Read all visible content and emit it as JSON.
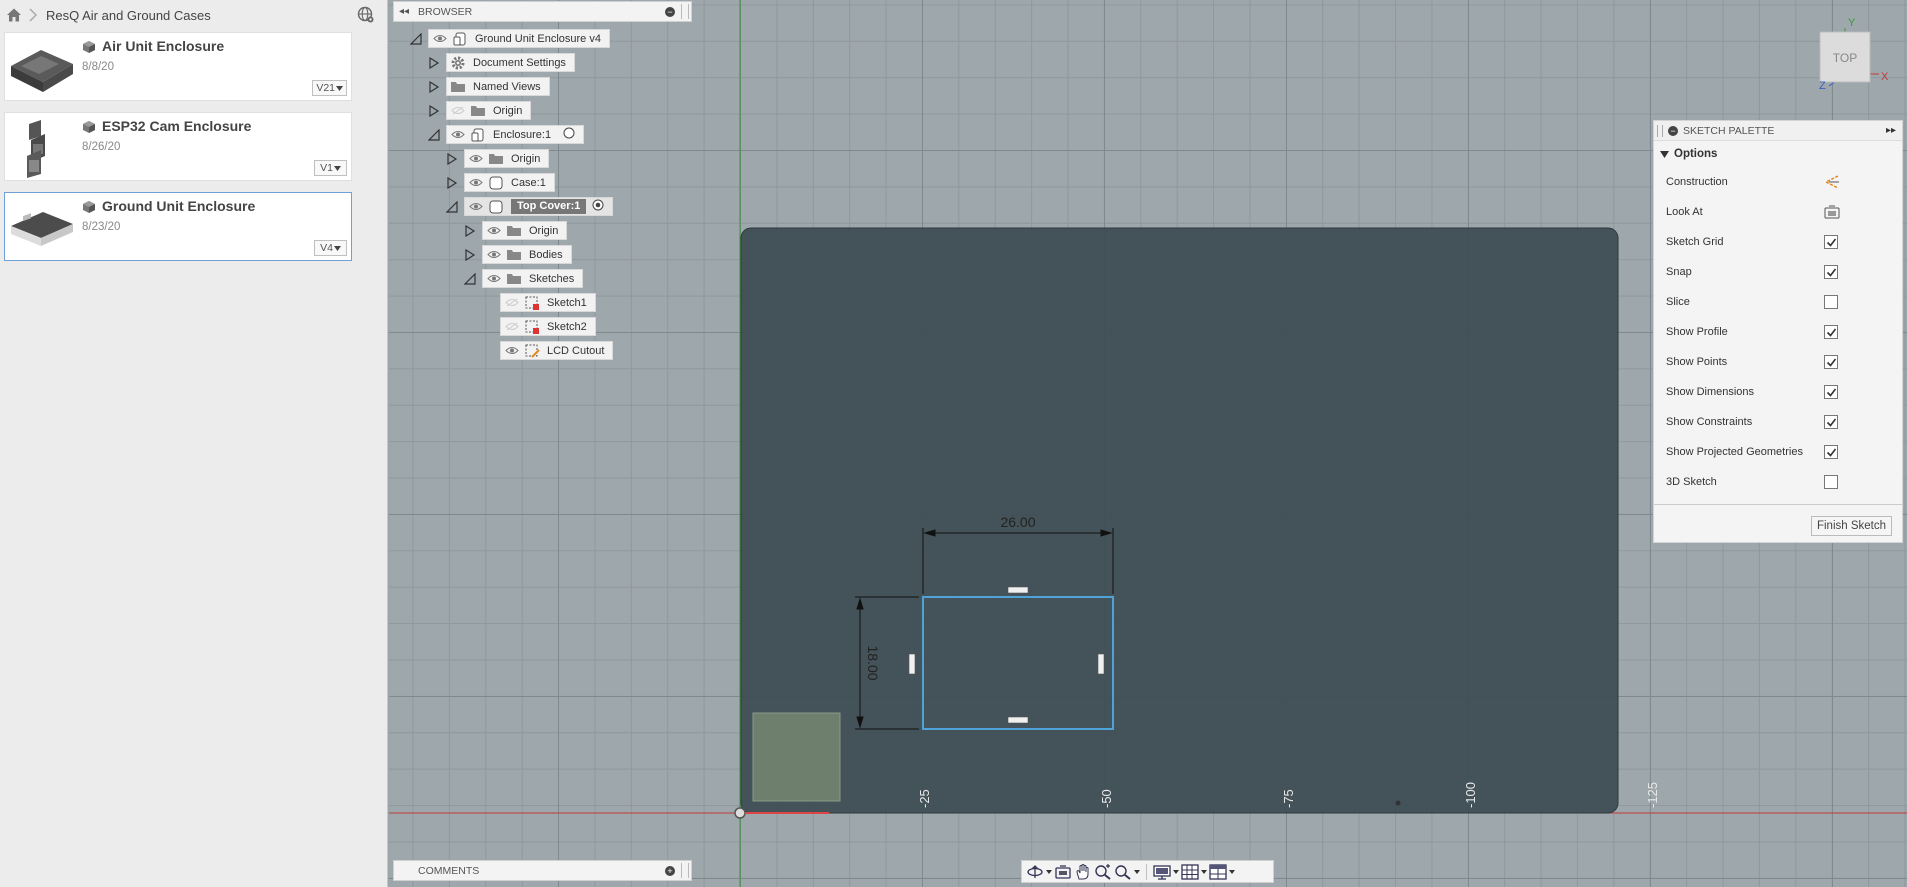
{
  "breadcrumb": {
    "project": "ResQ Air and Ground Cases"
  },
  "designs": [
    {
      "name": "Air Unit Enclosure",
      "date": "8/8/20",
      "version": "V21"
    },
    {
      "name": "ESP32 Cam Enclosure",
      "date": "8/26/20",
      "version": "V1"
    },
    {
      "name": "Ground Unit Enclosure",
      "date": "8/23/20",
      "version": "V4"
    }
  ],
  "browser": {
    "title": "BROWSER",
    "items": [
      {
        "label": "Ground Unit Enclosure v4"
      },
      {
        "label": "Document Settings"
      },
      {
        "label": "Named Views"
      },
      {
        "label": "Origin"
      },
      {
        "label": "Enclosure:1"
      },
      {
        "label": "Origin"
      },
      {
        "label": "Case:1"
      },
      {
        "label": "Top Cover:1"
      },
      {
        "label": "Origin"
      },
      {
        "label": "Bodies"
      },
      {
        "label": "Sketches"
      },
      {
        "label": "Sketch1"
      },
      {
        "label": "Sketch2"
      },
      {
        "label": "LCD Cutout"
      }
    ]
  },
  "comments": {
    "title": "COMMENTS"
  },
  "palette": {
    "title": "SKETCH PALETTE",
    "section": "Options",
    "options": [
      {
        "label": "Construction",
        "control": "construction-icon"
      },
      {
        "label": "Look At",
        "control": "look-at-icon"
      },
      {
        "label": "Sketch Grid",
        "checked": true
      },
      {
        "label": "Snap",
        "checked": true
      },
      {
        "label": "Slice",
        "checked": false
      },
      {
        "label": "Show Profile",
        "checked": true
      },
      {
        "label": "Show Points",
        "checked": true
      },
      {
        "label": "Show Dimensions",
        "checked": true
      },
      {
        "label": "Show Constraints",
        "checked": true
      },
      {
        "label": "Show Projected Geometries",
        "checked": true
      },
      {
        "label": "3D Sketch",
        "checked": false
      }
    ],
    "finish_label": "Finish Sketch"
  },
  "sketch": {
    "dimension_width": "26.00",
    "dimension_height": "18.00",
    "axis_labels": [
      "-25",
      "-50",
      "-75",
      "-100",
      "-125"
    ]
  },
  "viewcube": {
    "face": "TOP",
    "axis_x": "X",
    "axis_y": "Y",
    "axis_z": "Z"
  },
  "colors": {
    "sketch_blue": "#4fa3d8",
    "body_fill": "#3d4b52",
    "selection_border": "#6fa0d8"
  }
}
